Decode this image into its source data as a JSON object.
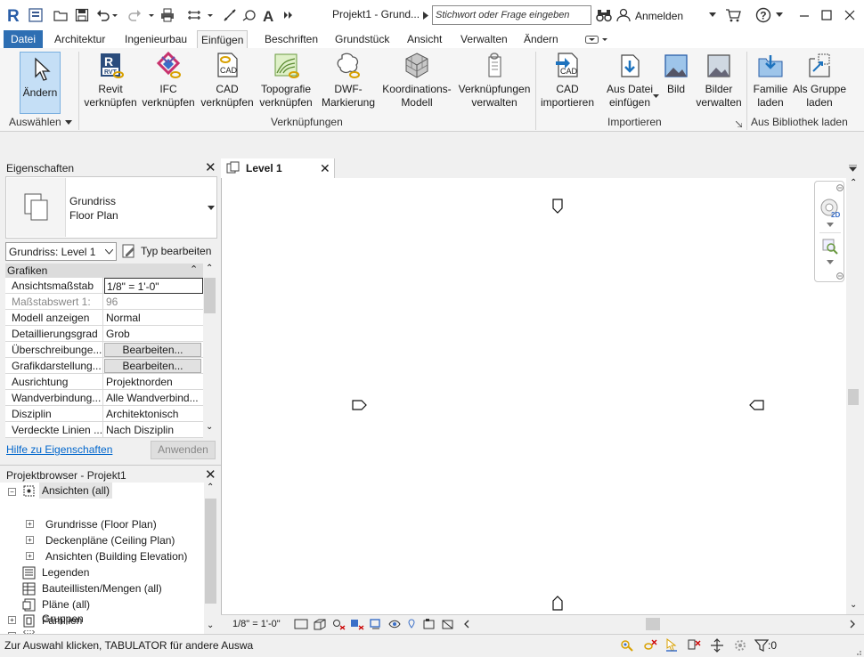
{
  "titlebar": {
    "title": "Projekt1 - Grund...",
    "search_placeholder": "Stichwort oder Frage eingeben",
    "signin": "Anmelden"
  },
  "tabs": [
    "Datei",
    "Architektur",
    "Ingenieurbau",
    "Einfügen",
    "Beschriften",
    "Grundstück",
    "Ansicht",
    "Verwalten",
    "Ändern"
  ],
  "active_tab": "Einfügen",
  "ribbon": {
    "modify": "Ändern",
    "select_panel": "Auswählen",
    "link_panel": "Verknüpfungen",
    "import_panel": "Importieren",
    "library_panel": "Aus Bibliothek laden",
    "buttons": [
      {
        "l1": "Revit",
        "l2": "verknüpfen"
      },
      {
        "l1": "IFC",
        "l2": "verknüpfen"
      },
      {
        "l1": "CAD",
        "l2": "verknüpfen"
      },
      {
        "l1": "Topografie",
        "l2": "verknüpfen"
      },
      {
        "l1": "DWF-",
        "l2": "Markierung"
      },
      {
        "l1": "Koordinations-",
        "l2": "Modell"
      },
      {
        "l1": "Verknüpfungen",
        "l2": "verwalten"
      },
      {
        "l1": "CAD",
        "l2": "importieren"
      },
      {
        "l1": "Aus Datei",
        "l2": "einfügen"
      },
      {
        "l1": "Bild",
        "l2": ""
      },
      {
        "l1": "Bilder",
        "l2": "verwalten"
      },
      {
        "l1": "Familie",
        "l2": "laden"
      },
      {
        "l1": "Als Gruppe",
        "l2": "laden"
      }
    ],
    "icon_badges": {
      "revit": "RVT",
      "cad": "CAD",
      "cadimport": "CAD"
    }
  },
  "properties": {
    "title": "Eigenschaften",
    "type_l1": "Grundriss",
    "type_l2": "Floor Plan",
    "instance_select": "Grundriss: Level 1",
    "edit_type": "Typ bearbeiten",
    "group": "Grafiken",
    "rows": [
      {
        "k": "Ansichtsmaßstab",
        "v": "1/8\" = 1'-0\""
      },
      {
        "k": "Maßstabswert 1:",
        "v": "96"
      },
      {
        "k": "Modell anzeigen",
        "v": "Normal"
      },
      {
        "k": "Detaillierungsgrad",
        "v": "Grob"
      },
      {
        "k": "Überschreibunge...",
        "v": "Bearbeiten..."
      },
      {
        "k": "Grafikdarstellung...",
        "v": "Bearbeiten..."
      },
      {
        "k": "Ausrichtung",
        "v": "Projektnorden"
      },
      {
        "k": "Wandverbindung...",
        "v": "Alle Wandverbind..."
      },
      {
        "k": "Disziplin",
        "v": "Architektonisch"
      },
      {
        "k": "Verdeckte Linien ...",
        "v": "Nach Disziplin"
      }
    ],
    "help": "Hilfe zu Eigenschaften",
    "apply": "Anwenden"
  },
  "browser": {
    "title": "Projektbrowser - Projekt1",
    "items": [
      {
        "label": "Ansichten (all)"
      },
      {
        "label": "Grundrisse (Floor Plan)"
      },
      {
        "label": "Deckenpläne (Ceiling Plan)"
      },
      {
        "label": "Ansichten (Building Elevation)"
      },
      {
        "label": "Legenden"
      },
      {
        "label": "Bauteillisten/Mengen (all)"
      },
      {
        "label": "Pläne (all)"
      },
      {
        "label": "Familien"
      },
      {
        "label": "Gruppen"
      }
    ]
  },
  "view": {
    "tab": "Level 1",
    "scale": "1/8\" = 1'-0\""
  },
  "status": {
    "text": "Zur Auswahl klicken, TABULATOR für andere Auswa",
    "filter_count": ":0"
  },
  "colors": {
    "file_tab": "#2e6fb3",
    "accent": "#1e73be",
    "link": "#0066cc"
  }
}
